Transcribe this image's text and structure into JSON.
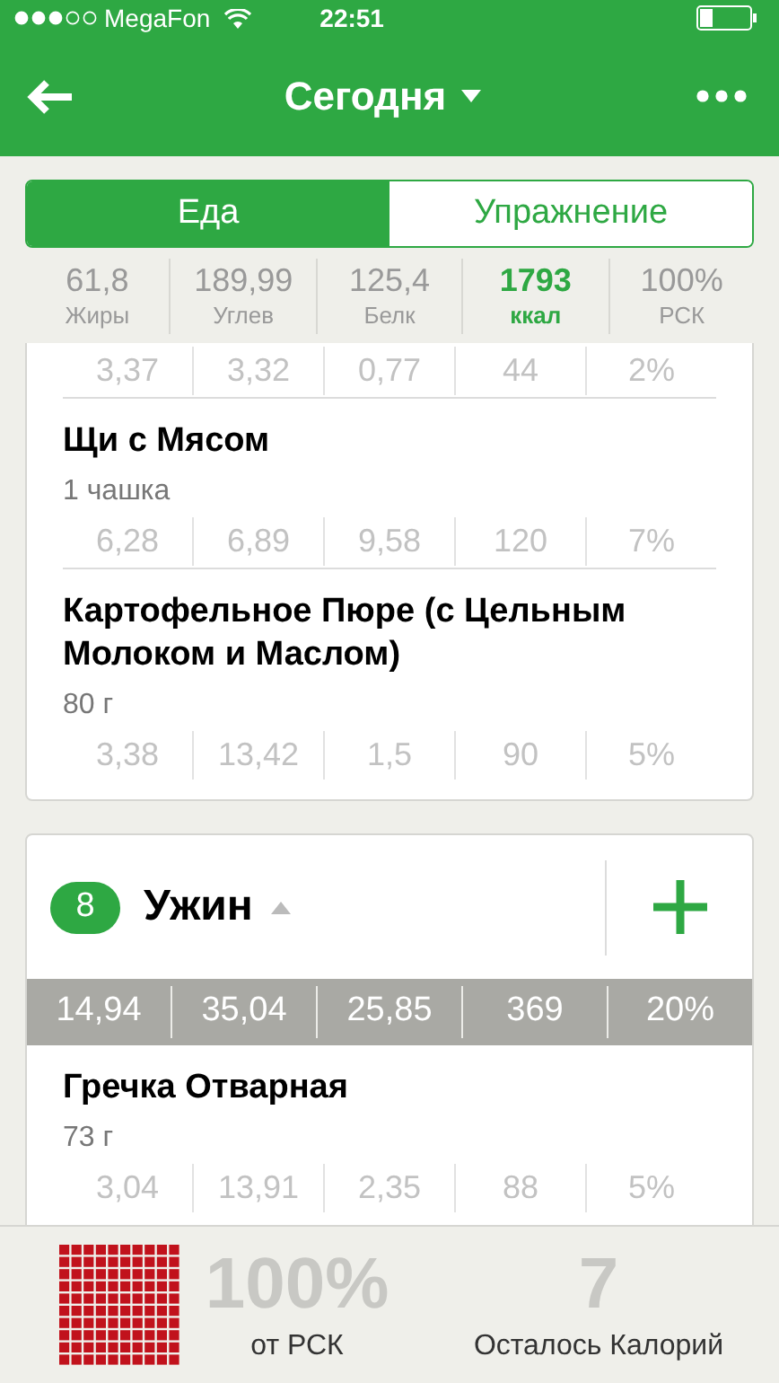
{
  "status_bar": {
    "carrier": "MegaFon",
    "time": "22:51"
  },
  "nav": {
    "title": "Сегодня"
  },
  "tabs": [
    {
      "label": "Еда",
      "selected": true
    },
    {
      "label": "Упражнение",
      "selected": false
    }
  ],
  "summary": [
    {
      "value": "61,8",
      "label": "Жиры",
      "highlighted": false
    },
    {
      "value": "189,99",
      "label": "Углев",
      "highlighted": false
    },
    {
      "value": "125,4",
      "label": "Белк",
      "highlighted": false
    },
    {
      "value": "1793",
      "label": "ккал",
      "highlighted": true
    },
    {
      "value": "100%",
      "label": "РСК",
      "highlighted": false
    }
  ],
  "meals": [
    {
      "items": [
        {
          "values": [
            "3,37",
            "3,32",
            "0,77",
            "44",
            "2%"
          ]
        },
        {
          "name": "Щи с Мясом",
          "serving": "1 чашка",
          "values": [
            "6,28",
            "6,89",
            "9,58",
            "120",
            "7%"
          ]
        },
        {
          "name": "Картофельное Пюре (с Цельным Молоком и Маслом)",
          "serving": "80 г",
          "values": [
            "3,38",
            "13,42",
            "1,5",
            "90",
            "5%"
          ]
        }
      ]
    },
    {
      "badge": "8",
      "name": "Ужин",
      "totals": [
        "14,94",
        "35,04",
        "25,85",
        "369",
        "20%"
      ],
      "items": [
        {
          "name": "Гречка Отварная",
          "serving": "73 г",
          "values": [
            "3,04",
            "13,91",
            "2,35",
            "88",
            "5%"
          ]
        }
      ]
    }
  ],
  "footer": {
    "percent": "100%",
    "percent_label": "от РСК",
    "remaining": "7",
    "remaining_label": "Осталось Калорий"
  }
}
